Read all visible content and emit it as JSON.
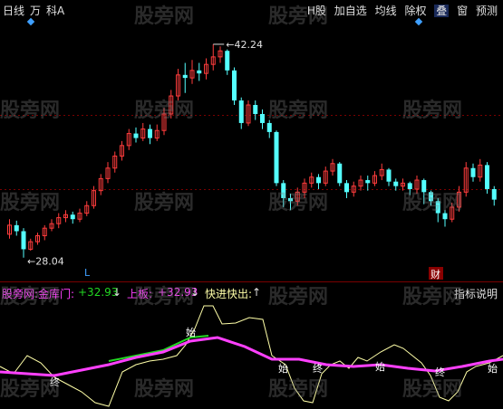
{
  "toolbar": {
    "left_items": [
      "日线",
      "万",
      "科A"
    ],
    "right_items": [
      "H股",
      "加自选",
      "均线",
      "除权",
      "叠",
      "窗",
      "预测"
    ]
  },
  "main_chart": {
    "high_label": "42.24",
    "low_label": "28.04",
    "marker_L": "L",
    "marker_cai": "财"
  },
  "indicator": {
    "name": "股旁网:金库门:",
    "value1": "+32.93",
    "arrow1": "↓",
    "name2": "上板:",
    "value2": "+32.93",
    "arrow2": "↓",
    "name3": "快进快出:",
    "arrow3": "↑",
    "explain_button": "指标说明",
    "signal_labels": [
      "始",
      "终",
      "始",
      "终",
      "始",
      "终",
      "始",
      "终"
    ]
  },
  "watermark_text": "股旁网",
  "colors": {
    "up": "#ff3c3c",
    "down": "#54ffff",
    "magenta": "#ff40ff",
    "green": "#22d822",
    "white_line": "#ffffa8",
    "grid": "#7a0000"
  },
  "chart_data": {
    "type": "candlestick",
    "high": 42.24,
    "low": 28.04,
    "candles": [
      [
        29.6,
        30.2,
        29.3,
        30.6
      ],
      [
        30.2,
        29.8,
        29.5,
        30.5
      ],
      [
        29.8,
        28.6,
        28.04,
        30.0
      ],
      [
        28.6,
        29.1,
        28.5,
        29.3
      ],
      [
        29.1,
        29.5,
        28.9,
        29.7
      ],
      [
        29.5,
        30.0,
        29.2,
        30.2
      ],
      [
        30.0,
        30.3,
        29.8,
        30.6
      ],
      [
        30.3,
        30.7,
        30.0,
        31.0
      ],
      [
        30.7,
        30.9,
        30.4,
        31.2
      ],
      [
        30.9,
        30.6,
        30.3,
        31.1
      ],
      [
        30.6,
        31.0,
        30.4,
        31.3
      ],
      [
        31.0,
        31.5,
        30.8,
        31.8
      ],
      [
        31.5,
        32.5,
        31.3,
        32.8
      ],
      [
        32.5,
        33.3,
        32.2,
        33.6
      ],
      [
        33.3,
        34.0,
        33.0,
        34.4
      ],
      [
        34.0,
        34.8,
        33.7,
        35.1
      ],
      [
        34.8,
        35.5,
        34.5,
        35.8
      ],
      [
        35.5,
        36.3,
        35.2,
        36.6
      ],
      [
        36.3,
        36.0,
        35.7,
        36.7
      ],
      [
        36.0,
        36.6,
        35.8,
        37.0
      ],
      [
        36.6,
        36.0,
        35.6,
        36.9
      ],
      [
        36.0,
        36.5,
        35.8,
        36.9
      ],
      [
        36.5,
        37.6,
        36.2,
        38.0
      ],
      [
        37.6,
        38.8,
        37.3,
        39.2
      ],
      [
        38.8,
        40.2,
        38.5,
        40.6
      ],
      [
        40.2,
        40.0,
        39.0,
        41.0
      ],
      [
        40.0,
        40.5,
        39.6,
        41.2
      ],
      [
        40.5,
        40.3,
        39.8,
        41.0
      ],
      [
        40.3,
        40.9,
        39.9,
        41.3
      ],
      [
        40.9,
        41.4,
        40.5,
        42.24
      ],
      [
        41.4,
        41.8,
        41.0,
        42.1
      ],
      [
        41.8,
        40.5,
        40.2,
        41.9
      ],
      [
        40.5,
        38.5,
        38.2,
        40.7
      ],
      [
        38.5,
        37.0,
        36.6,
        38.7
      ],
      [
        37.0,
        38.2,
        36.8,
        38.5
      ],
      [
        38.2,
        37.6,
        37.2,
        38.5
      ],
      [
        37.6,
        37.0,
        36.6,
        37.9
      ],
      [
        37.0,
        36.4,
        36.0,
        37.2
      ],
      [
        36.4,
        33.0,
        32.8,
        36.5
      ],
      [
        33.0,
        32.0,
        31.4,
        33.2
      ],
      [
        32.0,
        31.8,
        31.2,
        32.3
      ],
      [
        31.8,
        32.4,
        31.5,
        32.7
      ],
      [
        32.4,
        33.0,
        32.0,
        33.3
      ],
      [
        33.0,
        33.4,
        32.7,
        33.7
      ],
      [
        33.4,
        33.0,
        32.6,
        33.6
      ],
      [
        33.0,
        33.8,
        32.8,
        34.1
      ],
      [
        33.8,
        34.3,
        33.5,
        34.6
      ],
      [
        34.3,
        33.0,
        32.8,
        34.4
      ],
      [
        33.0,
        32.4,
        32.0,
        33.2
      ],
      [
        32.4,
        32.8,
        32.1,
        33.1
      ],
      [
        32.8,
        33.2,
        32.5,
        33.5
      ],
      [
        33.2,
        33.0,
        32.5,
        33.5
      ],
      [
        33.0,
        33.5,
        32.8,
        33.8
      ],
      [
        33.5,
        33.9,
        33.2,
        34.3
      ],
      [
        33.9,
        33.1,
        32.8,
        34.0
      ],
      [
        33.1,
        32.8,
        32.5,
        33.3
      ],
      [
        32.8,
        33.0,
        32.5,
        33.3
      ],
      [
        33.0,
        32.6,
        32.2,
        33.1
      ],
      [
        32.6,
        33.2,
        32.3,
        33.5
      ],
      [
        33.2,
        32.4,
        31.6,
        33.3
      ],
      [
        32.4,
        31.8,
        31.5,
        32.5
      ],
      [
        31.8,
        31.0,
        30.4,
        32.0
      ],
      [
        31.0,
        30.6,
        30.1,
        31.2
      ],
      [
        30.6,
        31.4,
        30.4,
        31.7
      ],
      [
        31.4,
        32.4,
        31.1,
        32.8
      ],
      [
        32.4,
        34.0,
        32.1,
        34.4
      ],
      [
        34.0,
        33.4,
        33.1,
        34.3
      ],
      [
        33.4,
        34.2,
        33.1,
        34.6
      ],
      [
        34.2,
        32.6,
        32.3,
        34.4
      ],
      [
        32.6,
        31.9,
        31.5,
        32.8
      ]
    ]
  }
}
